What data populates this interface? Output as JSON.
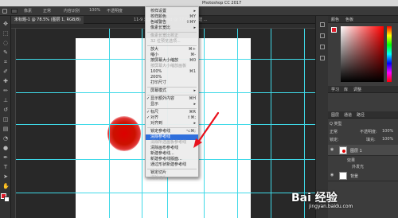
{
  "macbar": {
    "title": "Photoshop CC 2017"
  },
  "options_bar": {
    "fields": [
      "像素",
      "正常",
      "100%",
      "不透明度",
      "内容识别",
      "流量",
      "100%"
    ]
  },
  "doc_tabs": [
    {
      "label": "未标题-1 @ 78.5% (图层 1, RGB/8)",
      "active": true
    },
    {
      "label": "11-9 渐变效果图.psd @ 77.5% (新建 ...",
      "active": false
    }
  ],
  "menu": {
    "items": [
      {
        "label": "校样设置",
        "shortcut": "",
        "state": "sub"
      },
      {
        "label": "校样颜色",
        "shortcut": "⌘Y",
        "state": ""
      },
      {
        "label": "色域警告",
        "shortcut": "⇧⌘Y",
        "state": ""
      },
      {
        "label": "像素长宽比",
        "shortcut": "",
        "state": "sub"
      },
      {
        "label": "像素长宽比校正",
        "shortcut": "",
        "state": "dis"
      },
      {
        "label": "32 位预览选项...",
        "shortcut": "",
        "state": "dis"
      },
      {
        "label": "放大",
        "shortcut": "⌘+",
        "state": ""
      },
      {
        "label": "缩小",
        "shortcut": "⌘-",
        "state": ""
      },
      {
        "label": "按屏幕大小缩放",
        "shortcut": "⌘0",
        "state": ""
      },
      {
        "label": "按屏幕大小缩放画板",
        "shortcut": "",
        "state": "dis"
      },
      {
        "label": "100%",
        "shortcut": "⌘1",
        "state": ""
      },
      {
        "label": "200%",
        "shortcut": "",
        "state": ""
      },
      {
        "label": "打印尺寸",
        "shortcut": "",
        "state": ""
      },
      {
        "label": "屏幕模式",
        "shortcut": "",
        "state": "sub"
      },
      {
        "label": "显示额外内容",
        "shortcut": "⌘H",
        "state": "chk"
      },
      {
        "label": "显示",
        "shortcut": "",
        "state": "sub"
      },
      {
        "label": "标尺",
        "shortcut": "⌘R",
        "state": "chk"
      },
      {
        "label": "对齐",
        "shortcut": "⇧⌘;",
        "state": "chk"
      },
      {
        "label": "对齐到",
        "shortcut": "",
        "state": "sub"
      },
      {
        "label": "锁定参考线",
        "shortcut": "⌥⌘;",
        "state": ""
      },
      {
        "label": "清除参考线",
        "shortcut": "",
        "state": "hl"
      },
      {
        "label": "清除所选画板参考线",
        "shortcut": "",
        "state": "dis"
      },
      {
        "label": "清除画布参考线",
        "shortcut": "",
        "state": ""
      },
      {
        "label": "新建参考线...",
        "shortcut": "",
        "state": ""
      },
      {
        "label": "新建参考线版面...",
        "shortcut": "",
        "state": ""
      },
      {
        "label": "通过形状新建参考线",
        "shortcut": "",
        "state": ""
      },
      {
        "label": "锁定切片",
        "shortcut": "",
        "state": ""
      },
      {
        "label": "清除切片",
        "shortcut": "",
        "state": "dis"
      }
    ]
  },
  "panels": {
    "color_tabs": [
      "颜色",
      "色板"
    ],
    "props_tabs": [
      "学习",
      "库",
      "调整"
    ],
    "layers_tabs": [
      "图层",
      "通道",
      "路径"
    ],
    "layers_kind": "Q 类型",
    "blend_mode": "正常",
    "opacity_label": "不透明度:",
    "opacity_value": "100%",
    "lock_label": "锁定:",
    "fill_label": "填充:",
    "fill_value": "100%",
    "layers": [
      {
        "name": "图层 1",
        "selected": true,
        "effects": "效果"
      },
      {
        "name": "背景",
        "selected": false,
        "effects": ""
      }
    ],
    "effect_sub": "外发光"
  },
  "watermark": {
    "brand": "Bai 经验",
    "url": "jingyan.baidu.com"
  },
  "colors": {
    "foreground": "#e01b2a",
    "guide": "#3fd9e8",
    "highlight": "#2f6fdc"
  }
}
